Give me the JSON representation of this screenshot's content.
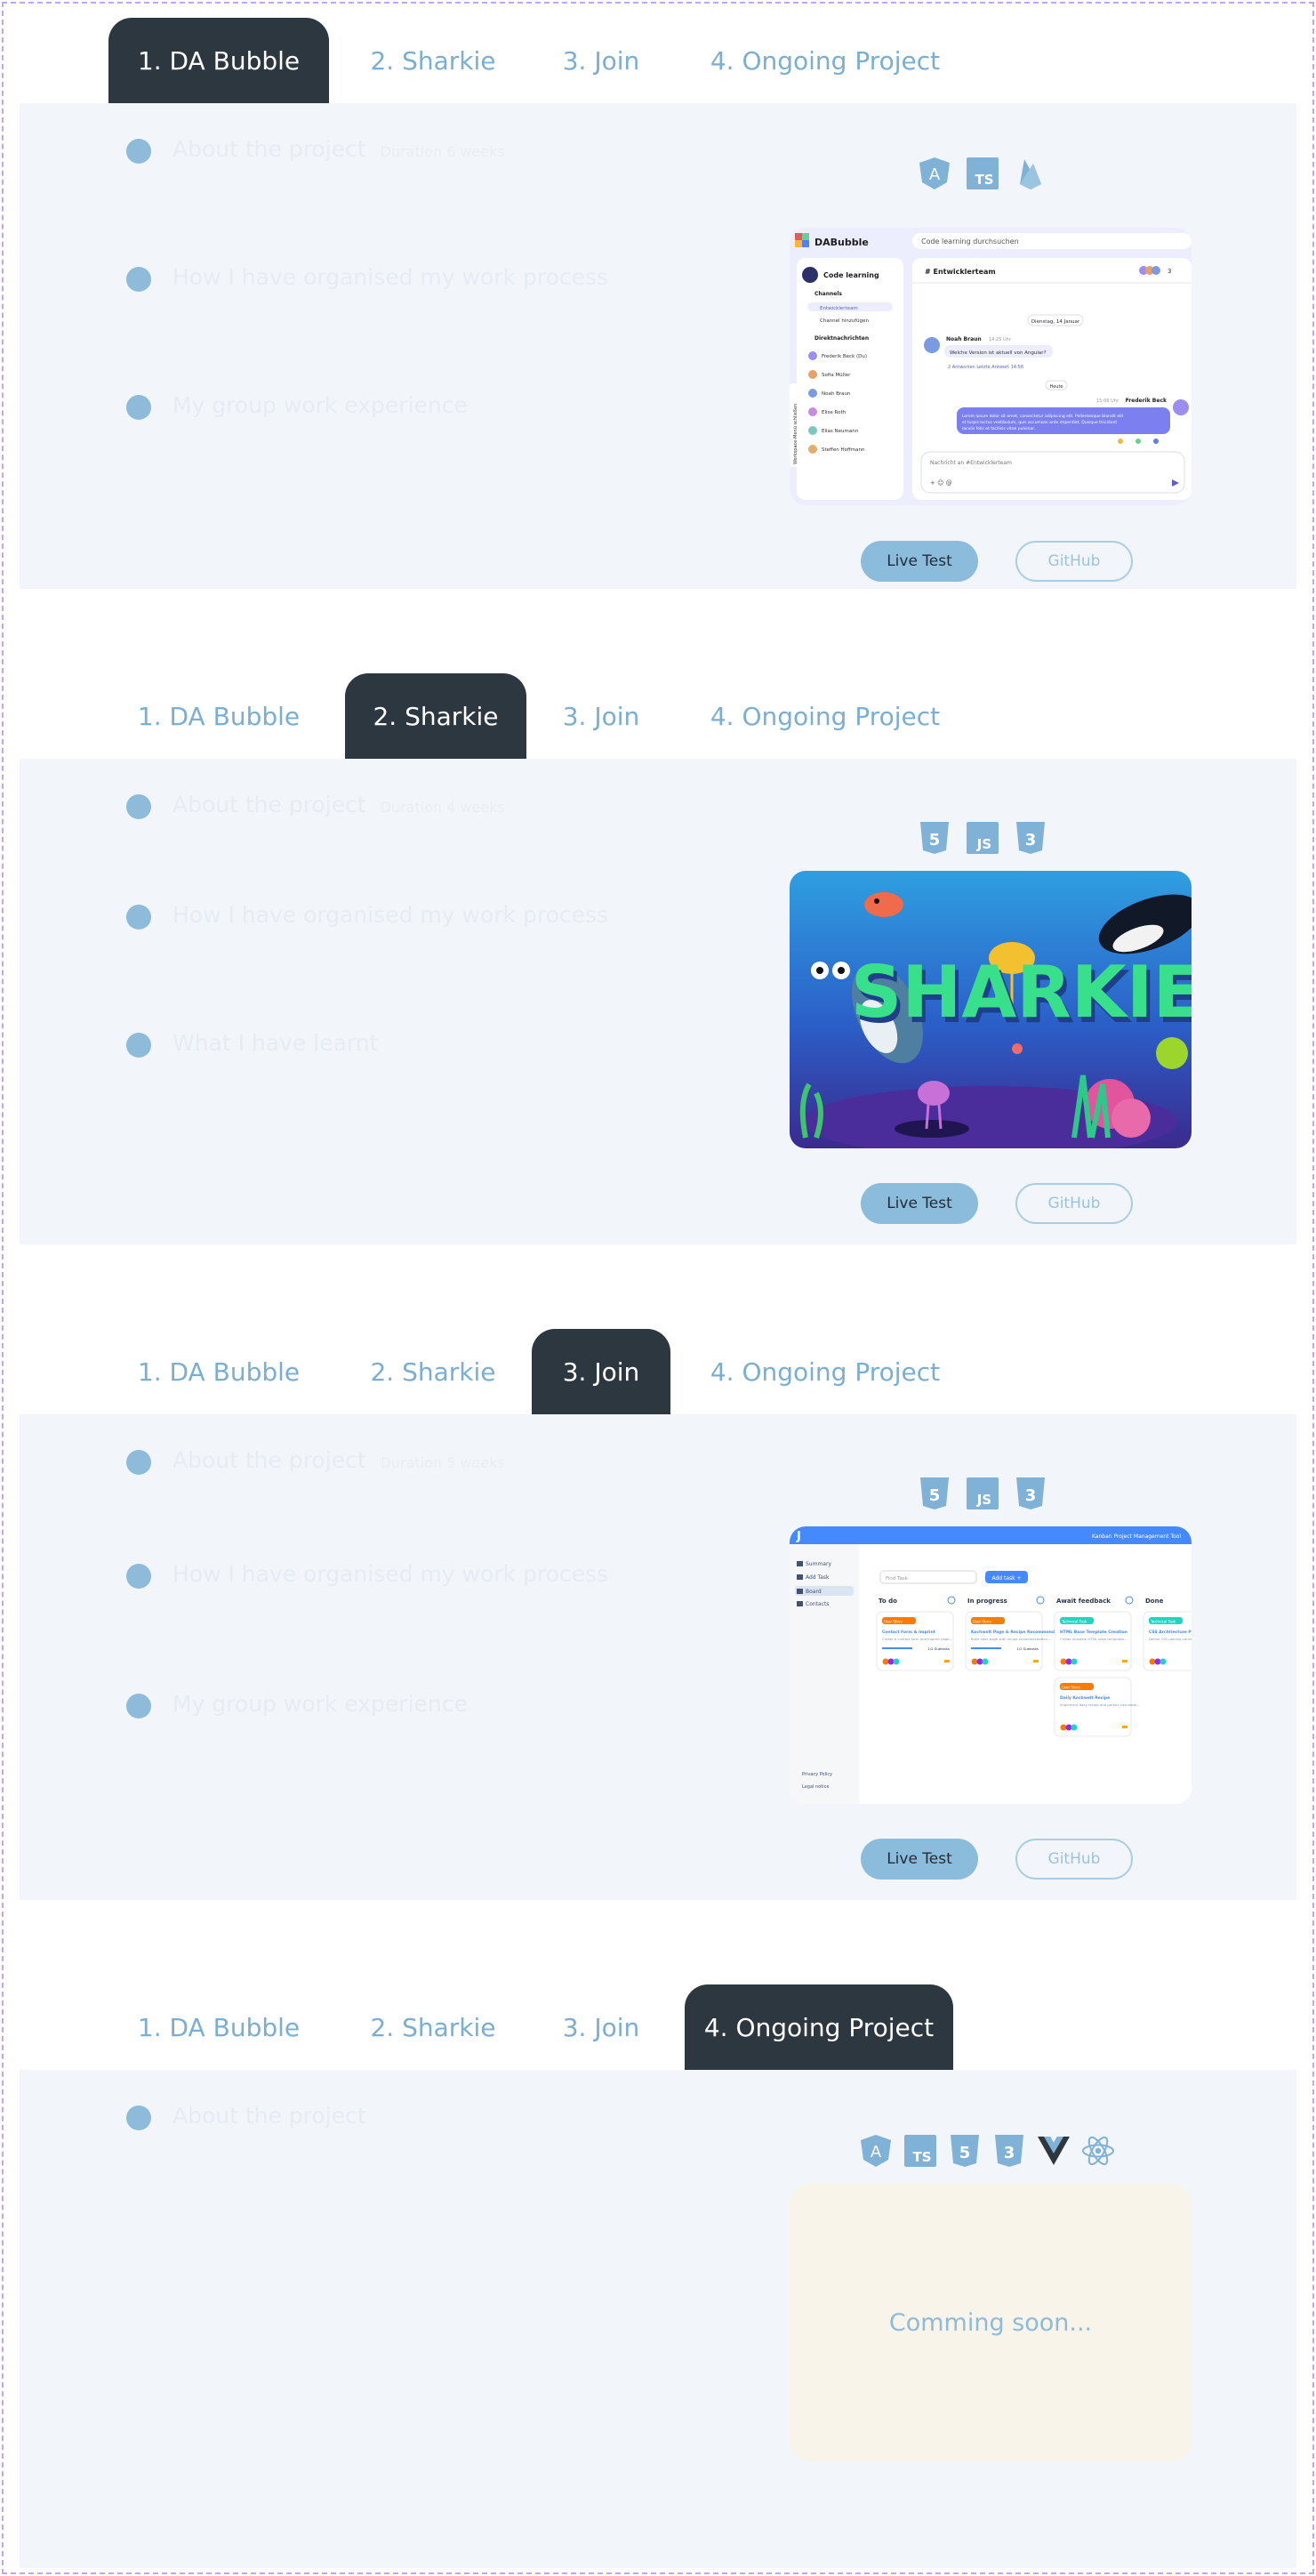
{
  "tabs": [
    "1. DA Bubble",
    "2. Sharkie",
    "3. Join",
    "4. Ongoing Project"
  ],
  "buttons": {
    "live": "Live Test",
    "github": "GitHub"
  },
  "projects": [
    {
      "headings": [
        "About the project",
        "How I have organised my work process",
        "My group work experience"
      ],
      "head_note": "Duration 6 weeks",
      "tech_icons": [
        "angular-icon",
        "typescript-icon",
        "firebase-icon"
      ],
      "icon_labels": [
        "A",
        "TS",
        ""
      ],
      "screenshot": {
        "app_name": "DABubble",
        "search_placeholder": "Code learning durchsuchen",
        "workspace": "Code learning",
        "channels_label": "Channels",
        "channel_items": [
          "Entwicklerteam",
          "Channel hinzufügen"
        ],
        "dm_label": "Direktnachrichten",
        "dm_items": [
          "Frederik Beck (Du)",
          "Sofia Müller",
          "Noah Braun",
          "Elise Roth",
          "Elias Neumann",
          "Steffen Hoffmann"
        ],
        "channel_title": "# Entwicklerteam",
        "member_count": "3",
        "date_label": "Dienstag, 14 Januar",
        "msg1_sender": "Noah Braun",
        "msg1_time": "14:25 Uhr",
        "msg1_text": "Welche Version ist aktuell von Angular?",
        "msg1_meta": "2 Antworten    Letzte Antwort 14:56",
        "divider_label": "Heute",
        "msg2_time": "15:06 Uhr",
        "msg2_sender": "Frederik Beck",
        "msg2_text": "Lorem ipsum dolor sit amet, consectetur adipiscing elit. Pellentesque blandit elit et turpis luctus vestibulum, quis accumsan ante imperdiet. Quisque tincidunt iaculis felis et facilisis vitae pulvinar.",
        "input_placeholder": "Nachricht an #Entwicklerteam",
        "side_toggle": "Workspace-Menü schließen"
      }
    },
    {
      "headings": [
        "About the project",
        "How I have organised my work process",
        "What I have learnt"
      ],
      "head_note": "Duration 4 weeks",
      "tech_icons": [
        "html5-icon",
        "javascript-icon",
        "css3-icon"
      ],
      "icon_labels": [
        "5",
        "JS",
        "3"
      ],
      "screenshot": {
        "title": "SHARKIE"
      }
    },
    {
      "headings": [
        "About the project",
        "How I have organised my work process",
        "My group work experience"
      ],
      "head_note": "Duration 5 weeks",
      "tech_icons": [
        "html5-icon",
        "javascript-icon",
        "css3-icon"
      ],
      "icon_labels": [
        "5",
        "JS",
        "3"
      ],
      "screenshot": {
        "logo": "J",
        "header_text": "Kanban Project Management Tool",
        "nav": [
          "Summary",
          "Add Task",
          "Board",
          "Contacts"
        ],
        "footer_links": [
          "Privacy Policy",
          "Legal notice"
        ],
        "search_placeholder": "Find Task",
        "add_task": "Add task +",
        "columns": [
          "To do",
          "In progress",
          "Await feedback",
          "Done"
        ],
        "cards": [
          {
            "col": 0,
            "tag": "User Story",
            "title": "Contact Form & Imprint",
            "desc": "Create a contact form and imprint page...",
            "sub": "1/2 Subtasks",
            "tagColor": "#ff7a00"
          },
          {
            "col": 1,
            "tag": "User Story",
            "title": "Kochwelt Page & Recipe Recommender",
            "desc": "Build start page with recipe recommendation...",
            "sub": "1/2 Subtasks",
            "tagColor": "#ff7a00"
          },
          {
            "col": 2,
            "tag": "Technical Task",
            "title": "HTML Base Template Creation",
            "desc": "Create reusable HTML base templates...",
            "sub": "",
            "tagColor": "#1fd7c1"
          },
          {
            "col": 2,
            "tag": "User Story",
            "title": "Daily Kochwelt Recipe",
            "desc": "Implement daily recipe and portion calculator...",
            "sub": "",
            "tagColor": "#ff7a00"
          },
          {
            "col": 3,
            "tag": "Technical Task",
            "title": "CSS Architecture Planning",
            "desc": "Define CSS naming conventions and structure...",
            "sub": "",
            "tagColor": "#1fd7c1"
          }
        ]
      }
    },
    {
      "headings": [
        "About the project"
      ],
      "head_note": "",
      "tech_icons": [
        "angular-icon",
        "typescript-icon",
        "html5-icon",
        "css3-icon",
        "vue-icon",
        "react-icon"
      ],
      "icon_labels": [
        "A",
        "TS",
        "5",
        "3",
        "",
        ""
      ],
      "coming_soon": "Comming soon..."
    }
  ]
}
